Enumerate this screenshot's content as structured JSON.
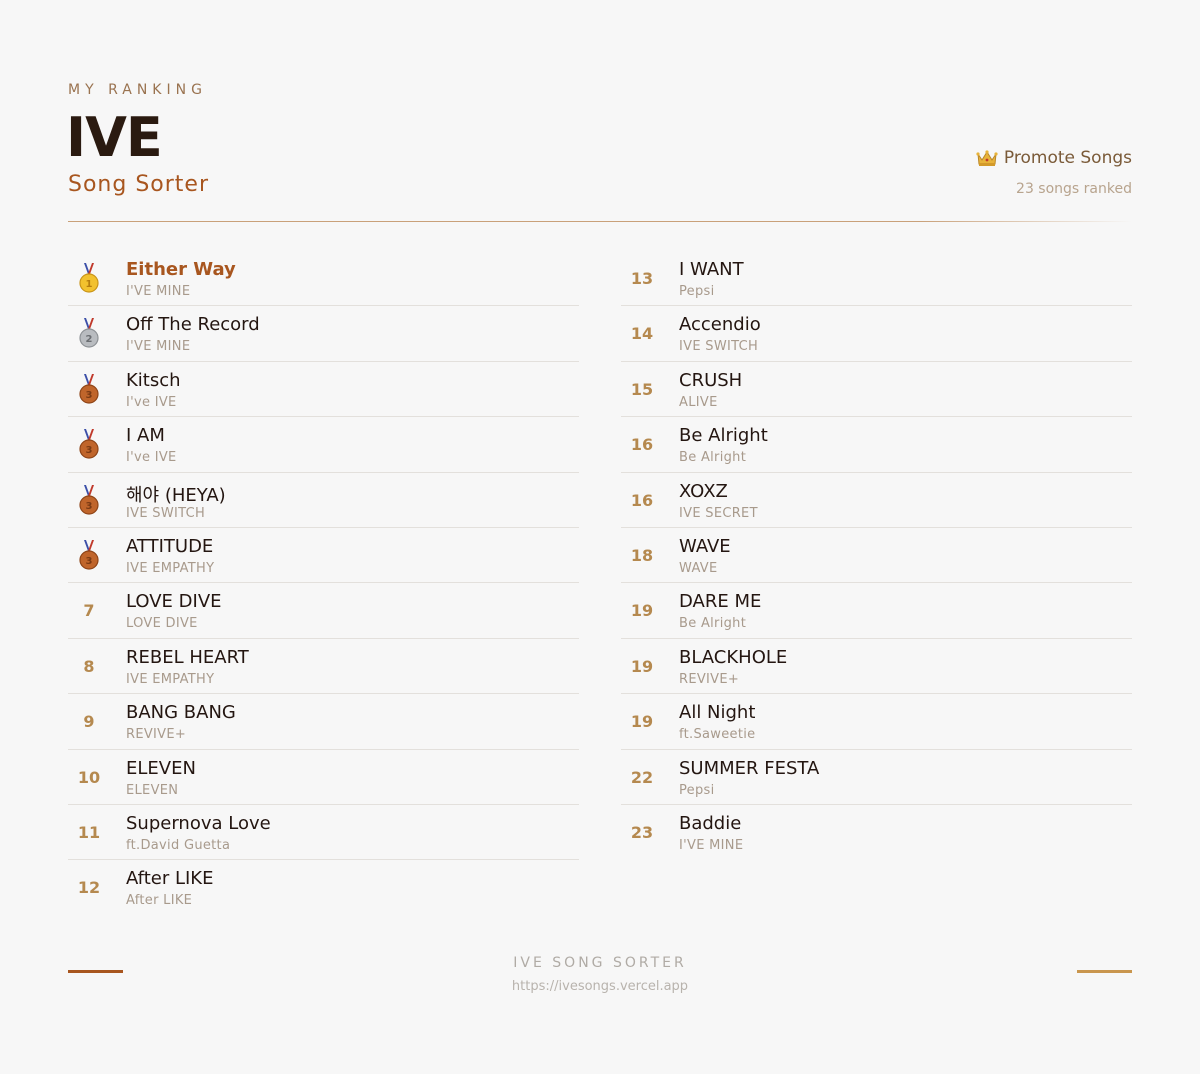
{
  "header": {
    "eyebrow": "MY RANKING",
    "title": "IVE",
    "subtitle": "Song Sorter",
    "promote": "Promote Songs",
    "count": "23 songs ranked"
  },
  "colors": {
    "accent": "#a8561f",
    "gold_rank": "#b5894f",
    "text": "#241611",
    "muted": "#a89a8c"
  },
  "left_list": [
    {
      "rank": "1",
      "medal": "gold-medal-icon",
      "song": "Either Way",
      "album": "I'VE MINE"
    },
    {
      "rank": "2",
      "medal": "silver-medal-icon",
      "song": "Off The Record",
      "album": "I'VE MINE"
    },
    {
      "rank": "3",
      "medal": "bronze-medal-icon",
      "song": "Kitsch",
      "album": "I've IVE"
    },
    {
      "rank": "3",
      "medal": "bronze-medal-icon",
      "song": "I AM",
      "album": "I've IVE"
    },
    {
      "rank": "3",
      "medal": "bronze-medal-icon",
      "song": "해야 (HEYA)",
      "album": "IVE SWITCH"
    },
    {
      "rank": "3",
      "medal": "bronze-medal-icon",
      "song": "ATTITUDE",
      "album": "IVE EMPATHY"
    },
    {
      "rank": "7",
      "song": "LOVE DIVE",
      "album": "LOVE DIVE"
    },
    {
      "rank": "8",
      "song": "REBEL HEART",
      "album": "IVE EMPATHY"
    },
    {
      "rank": "9",
      "song": "BANG BANG",
      "album": "REVIVE+"
    },
    {
      "rank": "10",
      "song": "ELEVEN",
      "album": "ELEVEN"
    },
    {
      "rank": "11",
      "song": "Supernova Love",
      "album": "ft.David Guetta"
    },
    {
      "rank": "12",
      "song": "After LIKE",
      "album": "After LIKE"
    }
  ],
  "right_list": [
    {
      "rank": "13",
      "song": "I WANT",
      "album": "Pepsi"
    },
    {
      "rank": "14",
      "song": "Accendio",
      "album": "IVE SWITCH"
    },
    {
      "rank": "15",
      "song": "CRUSH",
      "album": "ALIVE"
    },
    {
      "rank": "16",
      "song": "Be Alright",
      "album": "Be Alright"
    },
    {
      "rank": "16",
      "song": "XOXZ",
      "album": "IVE SECRET"
    },
    {
      "rank": "18",
      "song": "WAVE",
      "album": "WAVE"
    },
    {
      "rank": "19",
      "song": "DARE ME",
      "album": "Be Alright"
    },
    {
      "rank": "19",
      "song": "BLACKHOLE",
      "album": "REVIVE+"
    },
    {
      "rank": "19",
      "song": "All Night",
      "album": "ft.Saweetie"
    },
    {
      "rank": "22",
      "song": "SUMMER FESTA",
      "album": "Pepsi"
    },
    {
      "rank": "23",
      "song": "Baddie",
      "album": "I'VE MINE"
    }
  ],
  "footer": {
    "title": "IVE SONG SORTER",
    "url": "https://ivesongs.vercel.app"
  }
}
